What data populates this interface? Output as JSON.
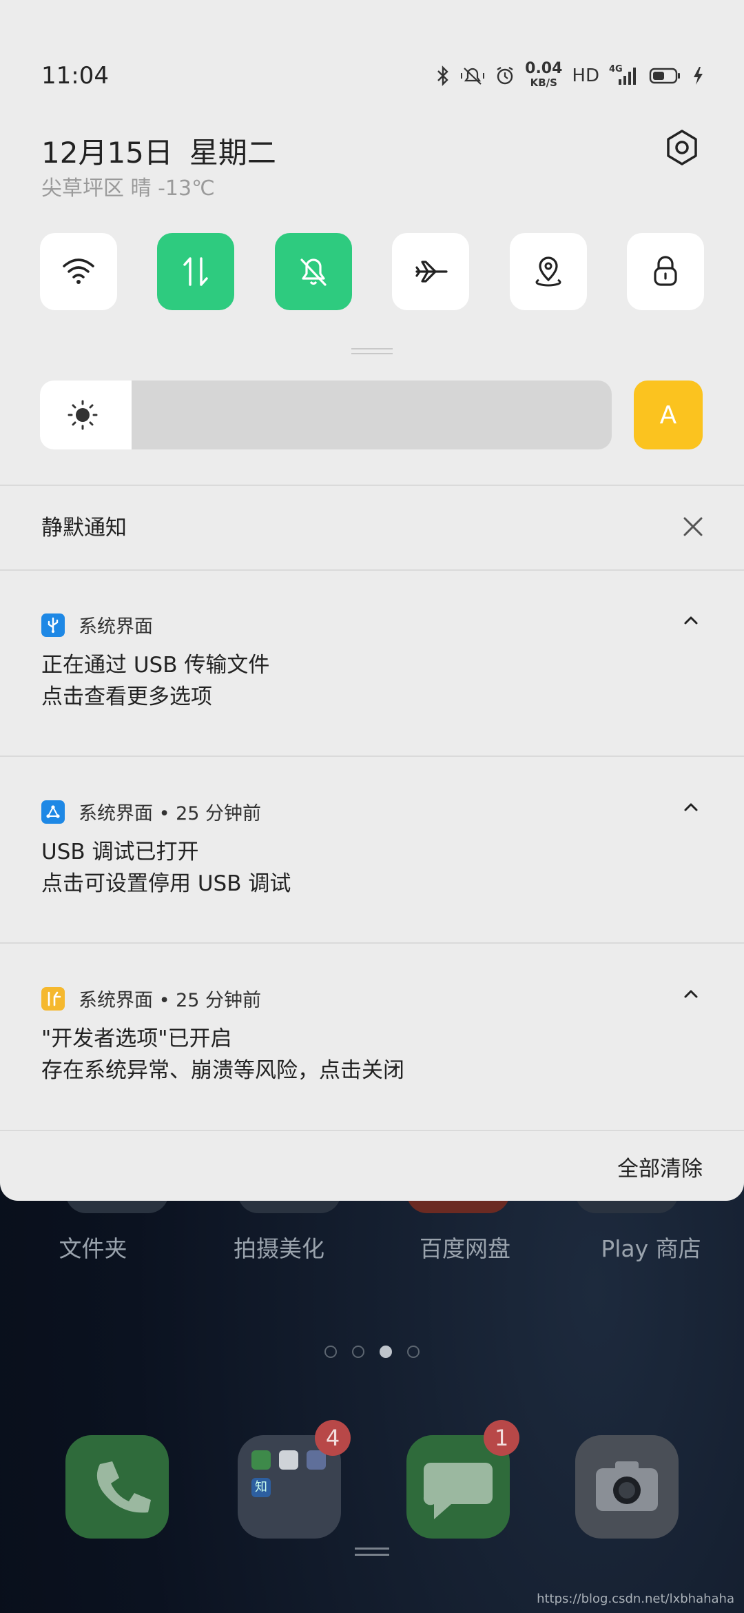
{
  "status_bar": {
    "time": "11:04",
    "speed_value": "0.04",
    "speed_unit": "KB/S",
    "hd": "HD",
    "network": "4G",
    "icons": [
      "bluetooth-icon",
      "vibrate-off-icon",
      "alarm-icon",
      "signal-icon",
      "battery-icon",
      "charging-icon"
    ]
  },
  "header": {
    "date": "12月15日",
    "weekday": "星期二",
    "weather": "尖草坪区 晴 -13℃"
  },
  "quick_tiles": [
    {
      "name": "wifi",
      "active": false
    },
    {
      "name": "mobile-data",
      "active": true
    },
    {
      "name": "silent-mode",
      "active": true
    },
    {
      "name": "airplane-mode",
      "active": false
    },
    {
      "name": "location",
      "active": false
    },
    {
      "name": "rotation-lock",
      "active": false
    }
  ],
  "brightness": {
    "level": 0.16,
    "auto_label": "A"
  },
  "silent_section": {
    "title": "静默通知"
  },
  "notifications": [
    {
      "icon": "usb-icon",
      "icon_color": "#1e88e5",
      "app": "系统界面",
      "title": "正在通过 USB 传输文件",
      "text": "点击查看更多选项"
    },
    {
      "icon": "debug-icon",
      "icon_color": "#1e88e5",
      "app": "系统界面 • 25 分钟前",
      "title": "USB 调试已打开",
      "text": "点击可设置停用 USB 调试"
    },
    {
      "icon": "developer-icon",
      "icon_color": "#f5b82e",
      "app": "系统界面 • 25 分钟前",
      "title": "\"开发者选项\"已开启",
      "text": "存在系统异常、崩溃等风险，点击关闭"
    }
  ],
  "clear_all": "全部清除",
  "home": {
    "app_labels": [
      "文件夹",
      "拍摄美化",
      "百度网盘",
      "Play 商店"
    ],
    "page_dots": 4,
    "active_dot": 2,
    "dock": [
      {
        "name": "phone-app",
        "badge": ""
      },
      {
        "name": "folder-app",
        "badge": "4"
      },
      {
        "name": "messages-app",
        "badge": "1"
      },
      {
        "name": "camera-app",
        "badge": ""
      }
    ],
    "watermark": "https://blog.csdn.net/lxbhahaha"
  }
}
